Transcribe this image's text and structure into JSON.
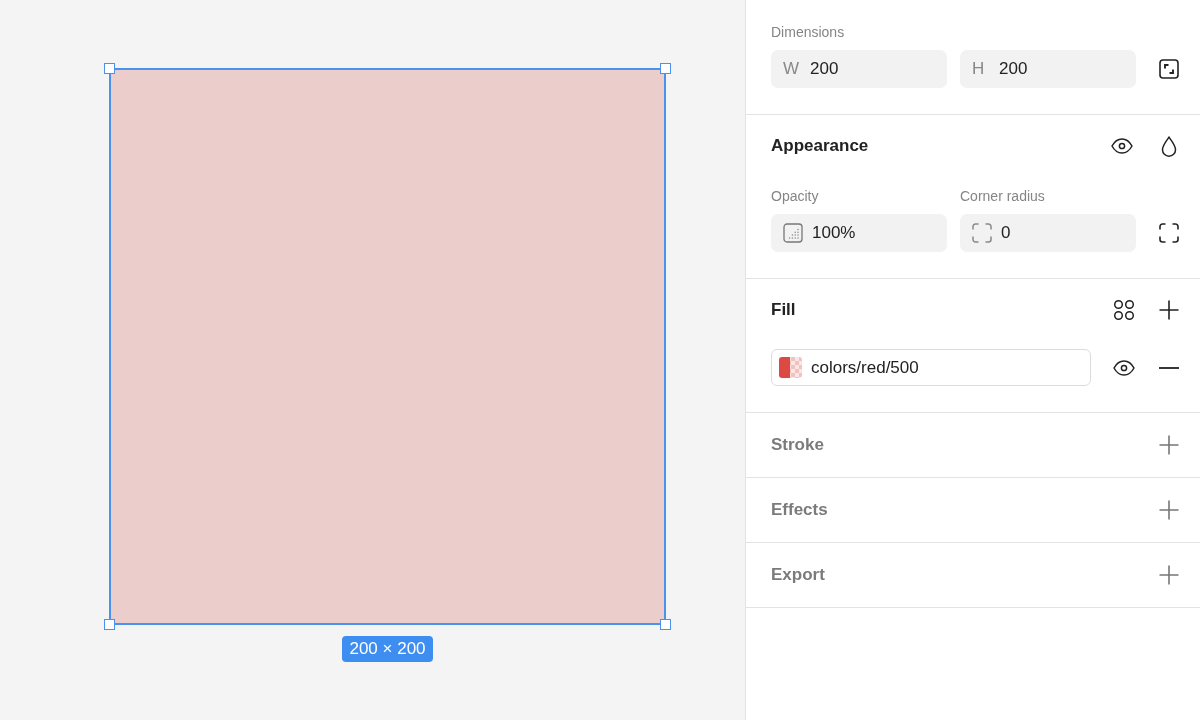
{
  "canvas": {
    "shape": {
      "selected": true
    },
    "size_label": "200 × 200"
  },
  "panel": {
    "dimensions": {
      "label": "Dimensions",
      "fields": [
        {
          "prefix": "W",
          "value": "200"
        },
        {
          "prefix": "H",
          "value": "200"
        }
      ]
    },
    "appearance": {
      "title": "Appearance",
      "fields": [
        {
          "label": "Opacity",
          "kind": "opacity",
          "value": "100%"
        },
        {
          "label": "Corner radius",
          "kind": "radius",
          "value": "0"
        }
      ]
    },
    "fill": {
      "title": "Fill",
      "layers": [
        {
          "name": "colors/red/500"
        }
      ]
    },
    "empty_sections": [
      {
        "title": "Stroke"
      },
      {
        "title": "Effects"
      },
      {
        "title": "Export"
      }
    ]
  }
}
